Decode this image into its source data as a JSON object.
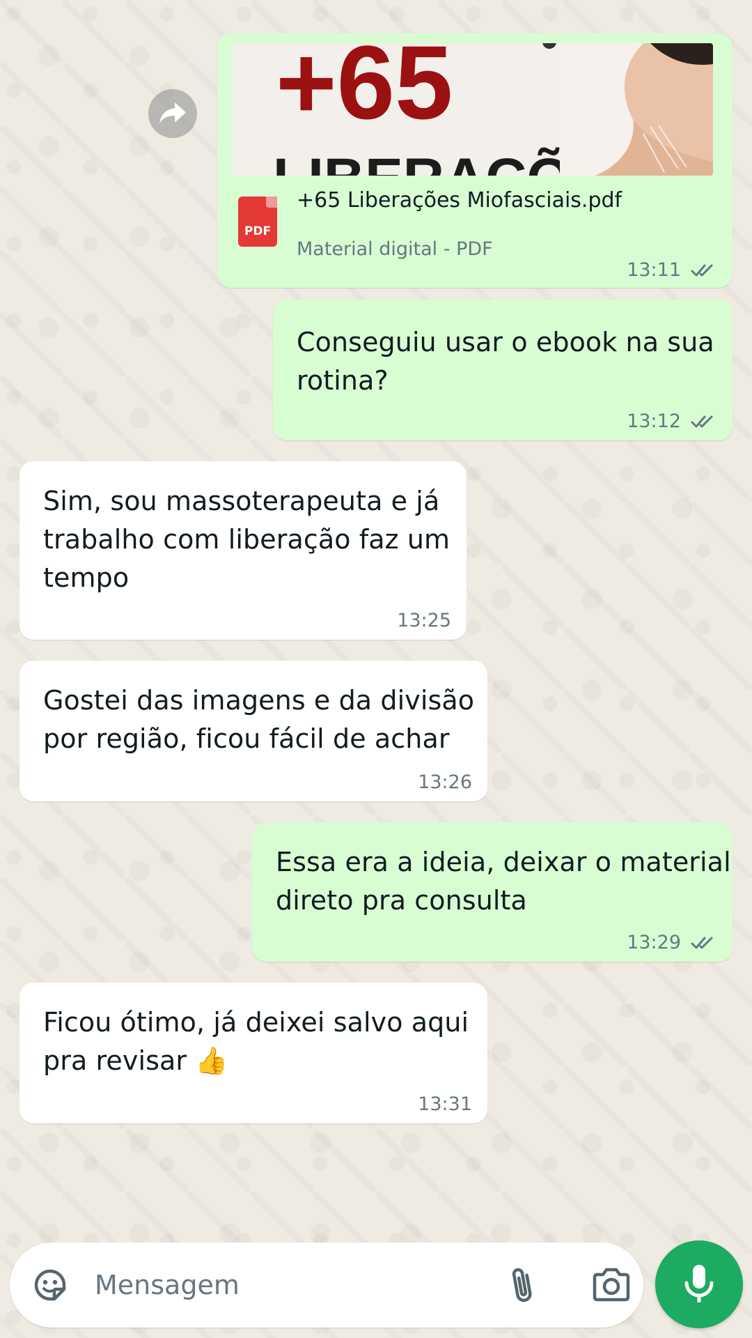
{
  "messages": [
    {
      "type": "document",
      "direction": "outgoing",
      "thumbnail_text": {
        "number": "+65",
        "word": "LIBERAÇÕES"
      },
      "file_name": "+65 Liberações Miofasciais.pdf",
      "file_badge": "PDF",
      "subtitle": "Material digital - PDF",
      "time": "13:11",
      "status": "read"
    },
    {
      "type": "text",
      "direction": "outgoing",
      "lines": [
        "Conseguiu usar o ebook na sua",
        "rotina?"
      ],
      "time": "13:12",
      "status": "read"
    },
    {
      "type": "text",
      "direction": "incoming",
      "lines": [
        "Sim, sou massoterapeuta e já",
        "trabalho com liberação faz um",
        "tempo"
      ],
      "time": "13:25"
    },
    {
      "type": "text",
      "direction": "incoming",
      "lines": [
        "Gostei das imagens e da divisão",
        "por região, ficou fácil de achar"
      ],
      "time": "13:26"
    },
    {
      "type": "text",
      "direction": "outgoing",
      "lines": [
        "Essa era a ideia, deixar o material",
        "direto pra consulta"
      ],
      "time": "13:29",
      "status": "read"
    },
    {
      "type": "text",
      "direction": "incoming",
      "lines": [
        "Ficou ótimo, já deixei salvo aqui",
        "pra revisar 👍"
      ],
      "time": "13:31"
    }
  ],
  "composer": {
    "placeholder": "Mensagem",
    "icons": [
      "sticker-icon",
      "paperclip-icon",
      "camera-icon",
      "microphone-icon"
    ]
  },
  "icons": {
    "forward": "forward-arrow-icon",
    "read_receipt": "double-check-icon"
  },
  "colors": {
    "outgoing_bubble": "#d9fdd3",
    "incoming_bubble": "#ffffff",
    "wallpaper": "#efeae2",
    "accent_green": "#1daa61",
    "pdf_red": "#e53935"
  }
}
